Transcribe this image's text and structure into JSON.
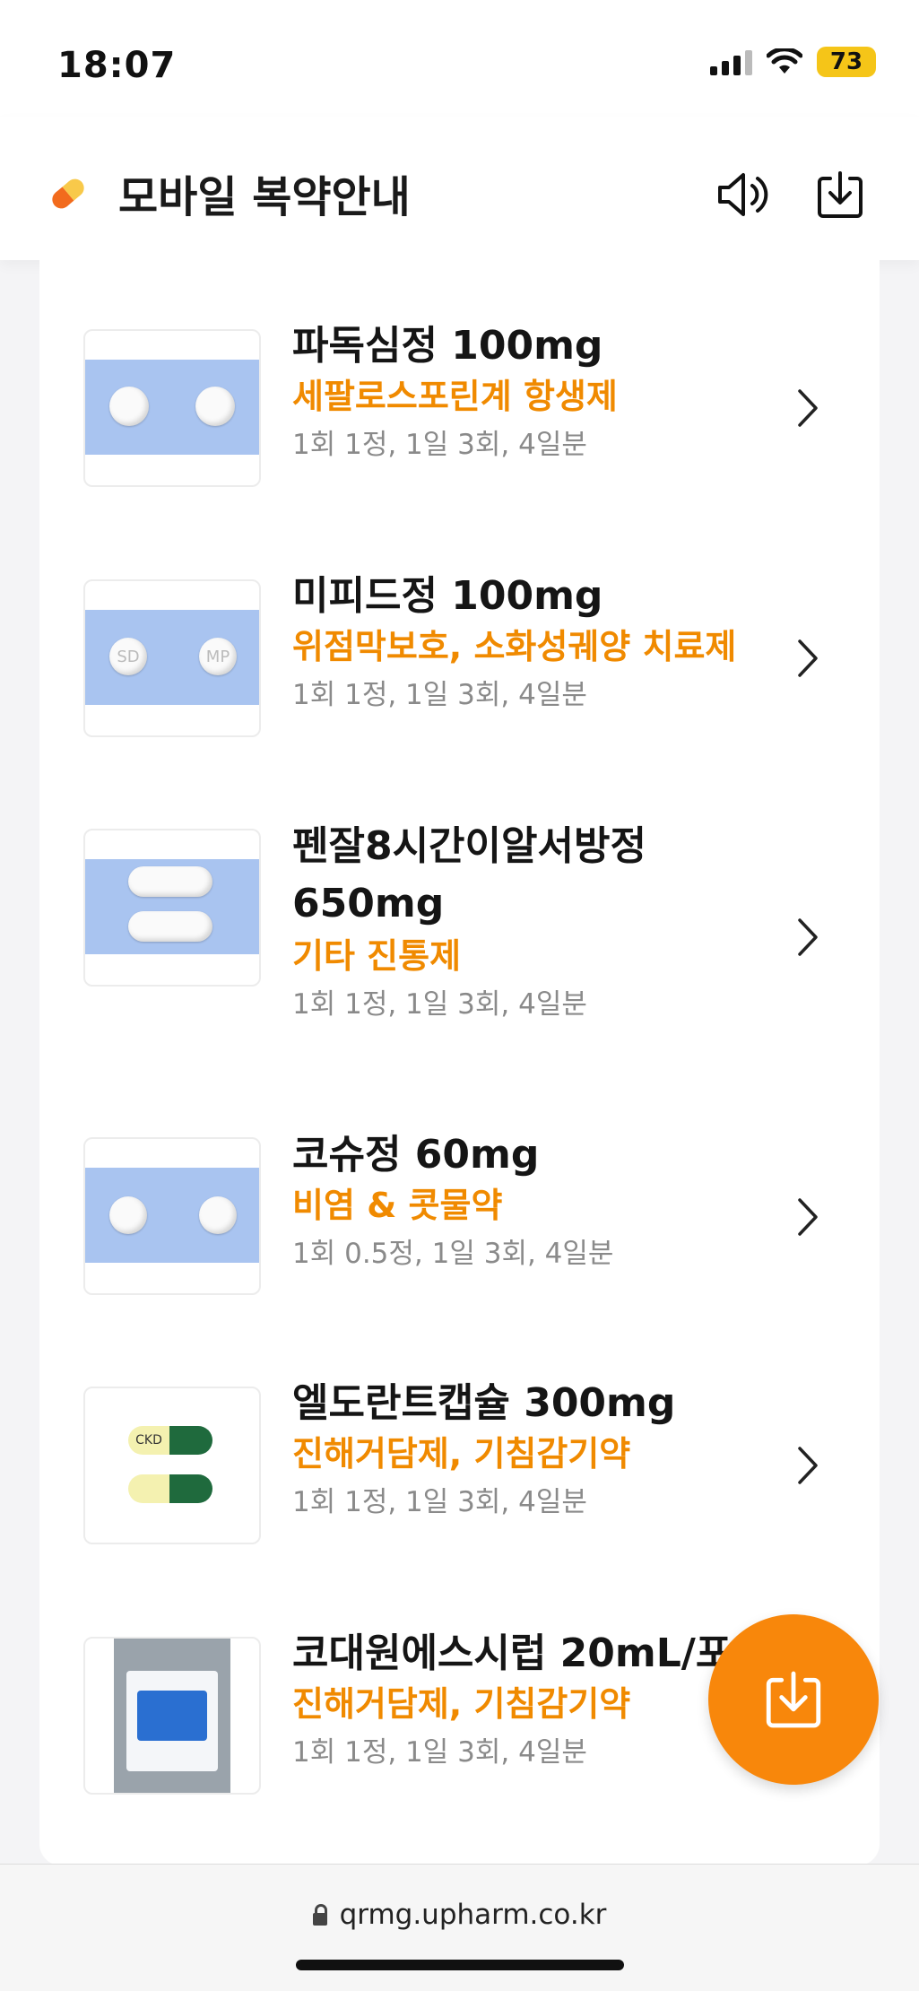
{
  "status": {
    "time": "18:07",
    "battery": "73"
  },
  "header": {
    "title": "모바일 복약안내",
    "sound_icon": "speaker-icon",
    "download_icon": "download-icon"
  },
  "medications": [
    {
      "name": "파독심정 100mg",
      "class": "세팔로스포린계 항생제",
      "dose": "1회 1정, 1일 3회, 4일분"
    },
    {
      "name": "미피드정 100mg",
      "class": "위점막보호, 소화성궤양 치료제",
      "dose": "1회 1정, 1일 3회, 4일분"
    },
    {
      "name_line1": "펜잘8시간이알서방정",
      "name_line2": "650mg",
      "class": "기타 진통제",
      "dose": "1회 1정, 1일 3회, 4일분"
    },
    {
      "name": "코슈정 60mg",
      "class": "비염 & 콧물약",
      "dose": "1회 0.5정, 1일 3회, 4일분"
    },
    {
      "name": "엘도란트캡슐 300mg",
      "class": "진해거담제, 기침감기약",
      "dose": "1회 1정, 1일 3회, 4일분"
    },
    {
      "name": "코대원에스시럽 20mL/포",
      "class": "진해거담제, 기침감기약",
      "dose": "1회 1정, 1일 3회, 4일분"
    }
  ],
  "browser": {
    "url": "qrmg.upharm.co.kr"
  },
  "colors": {
    "accent": "#f8870b",
    "class_text": "#f08a00",
    "pill_band": "#a9c4f0"
  }
}
